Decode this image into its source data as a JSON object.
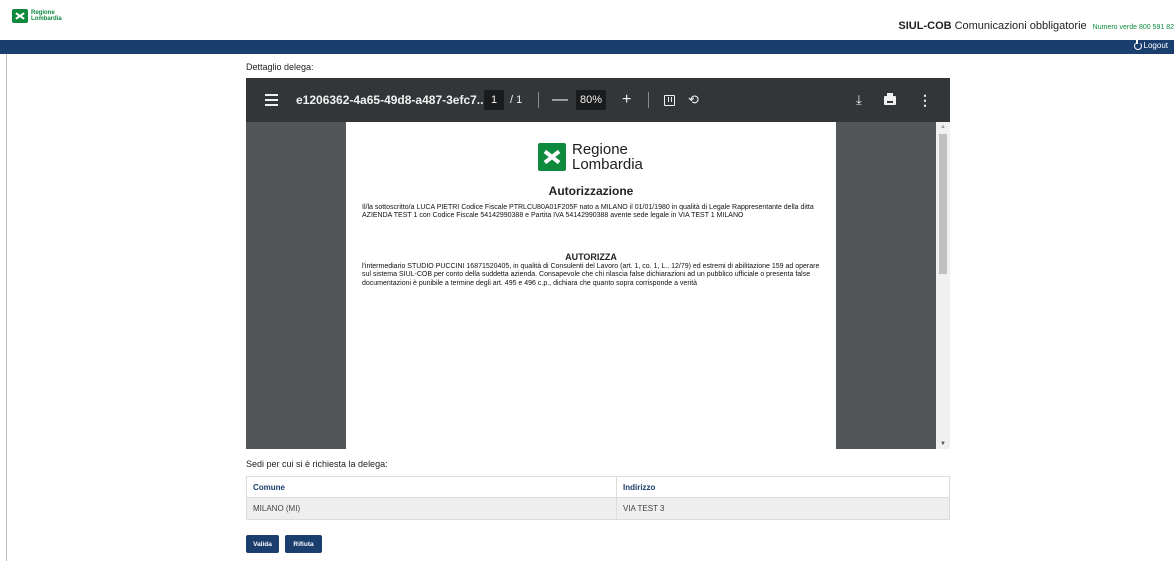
{
  "header": {
    "logo_text_line1": "Regione",
    "logo_text_line2": "Lombardia",
    "app_title_strong": "SIUL-COB",
    "app_title_rest": "Comunicazioni obbligatorie",
    "phone": "Numero verde 800 591 82",
    "logout_label": "Logout",
    "brand_color": "#1a3e6e",
    "accent_green": "#0e8a3e"
  },
  "main": {
    "detail_label": "Dettaglio delega:",
    "sedi_label": "Sedi per cui si è richiesta la delega:"
  },
  "viewer": {
    "file_name": "e1206362-4a65-49d8-a487-3efc7...",
    "page_current": "1",
    "page_total": "/ 1",
    "zoom": "80%",
    "icons": [
      "menu-icon",
      "zoom-out-icon",
      "zoom-in-icon",
      "fit-page-icon",
      "rotate-icon",
      "download-icon",
      "print-icon",
      "more-icon"
    ]
  },
  "document": {
    "logo_line1": "Regione",
    "logo_line2": "Lombardia",
    "title": "Autorizzazione",
    "paragraph1": "Il/la sottoscritto/a LUCA PIETRI Codice Fiscale PTRLCU80A01F205F nato a MILANO il 01/01/1980 in qualità di Legale Rappresentante della ditta AZIENDA TEST 1 con Codice Fiscale 54142990388 e Partita IVA 54142990388 avente sede legale in VIA TEST 1 MILANO",
    "subtitle": "AUTORIZZA",
    "paragraph2": "l'intermediario STUDIO PUCCINI 16871520405,  in qualità di Consulenti del Lavoro (art. 1, co. 1, L.. 12/79) ed estremi di abilitazione 159 ad operare sul sistema SIUL-COB per conto della suddetta azienda. Consapevole che chi rilascia false dichiarazioni ad un pubblico ufficiale o presenta false documentazioni è punibile a termine degli art. 495 e 496 c.p., dichiara che quanto sopra corrisponde a verità"
  },
  "table": {
    "headers": [
      "Comune",
      "Indirizzo"
    ],
    "rows": [
      [
        "MILANO (MI)",
        "VIA TEST 3"
      ]
    ]
  },
  "actions": {
    "validate_label": "Valida",
    "reject_label": "Rifiuta"
  }
}
